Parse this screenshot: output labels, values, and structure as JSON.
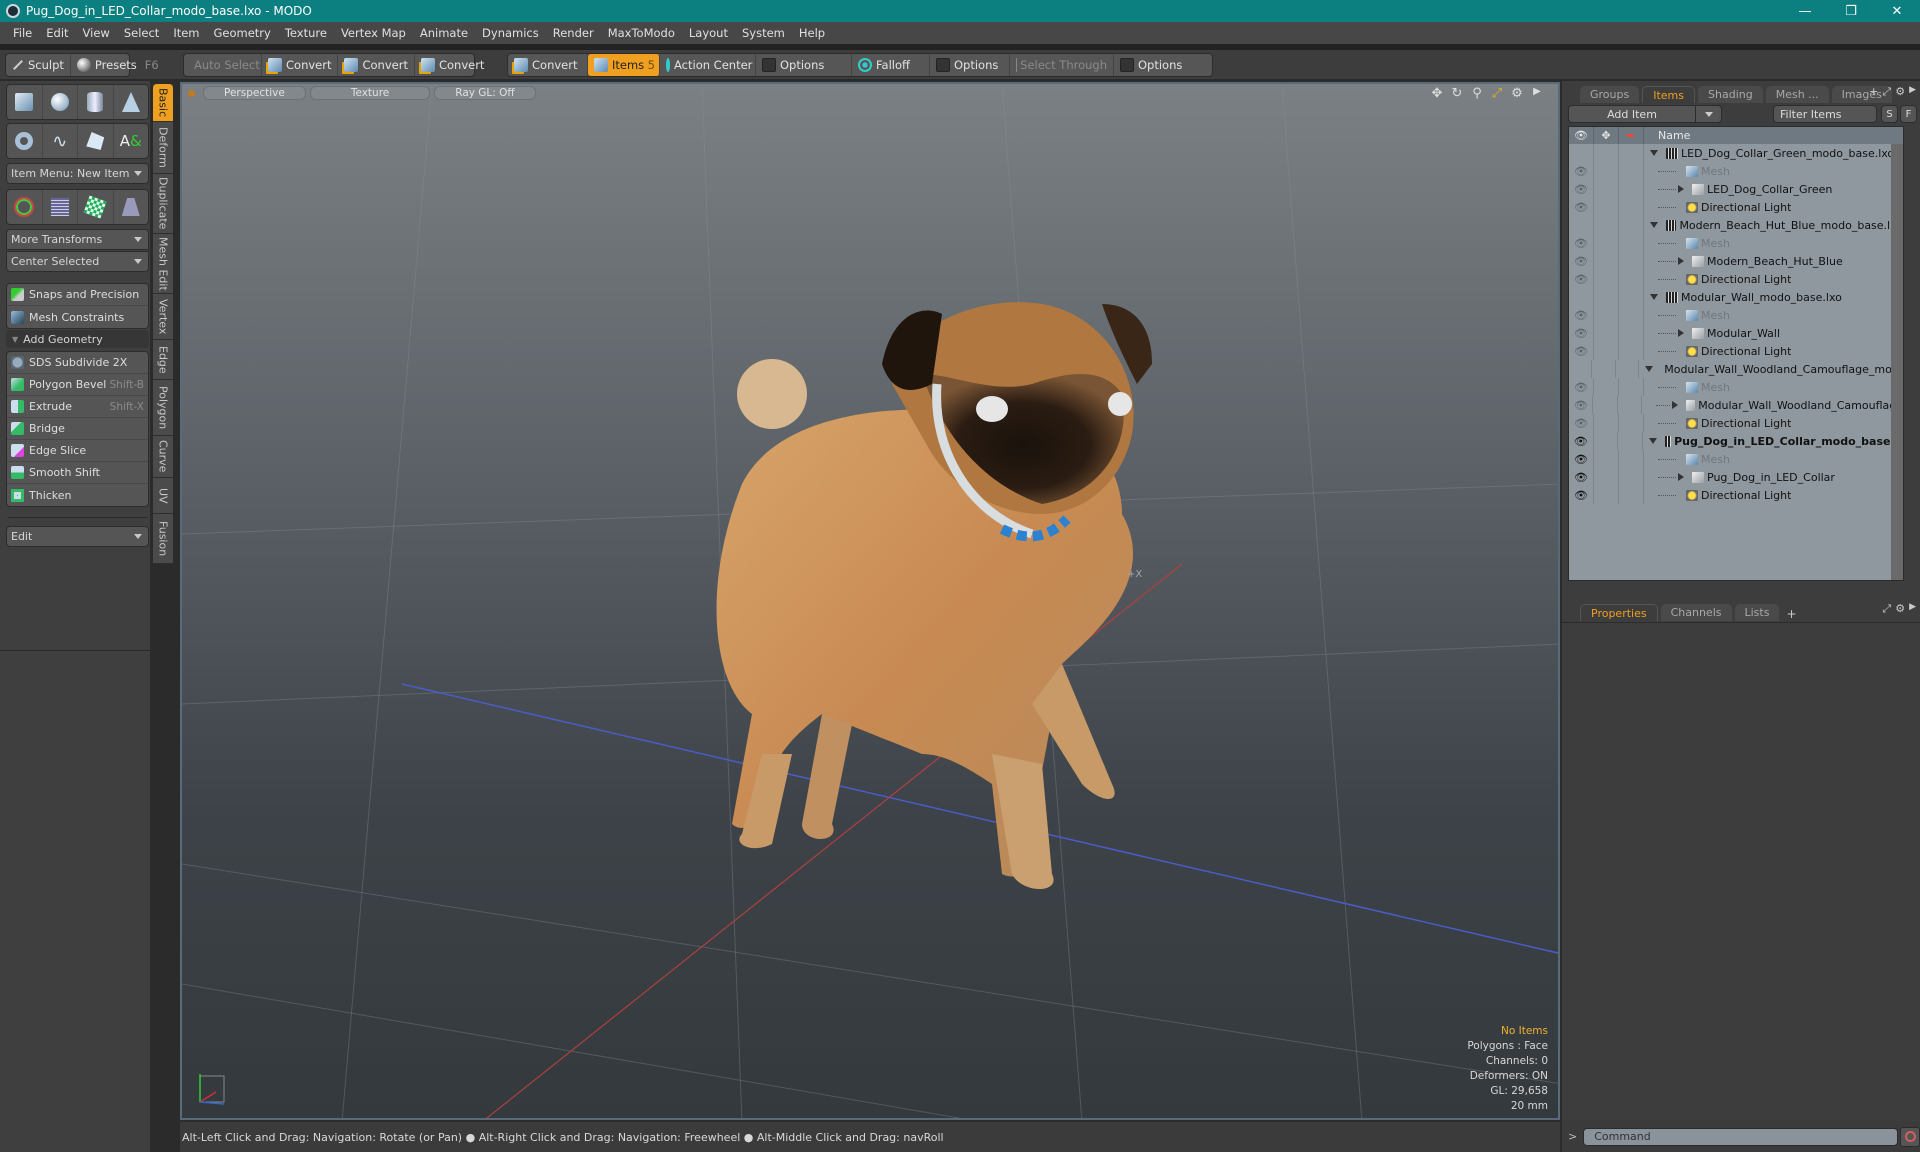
{
  "window": {
    "title": "Pug_Dog_in_LED_Collar_modo_base.lxo - MODO",
    "controls": [
      "minimize",
      "restore",
      "close"
    ]
  },
  "menu": [
    "File",
    "Edit",
    "View",
    "Select",
    "Item",
    "Geometry",
    "Texture",
    "Vertex Map",
    "Animate",
    "Dynamics",
    "Render",
    "MaxToModo",
    "Layout",
    "System",
    "Help"
  ],
  "toolbar": {
    "sculpt": "Sculpt",
    "presets": "Presets",
    "presets_shortcut": "F6",
    "auto_select": "Auto Select",
    "convert1": "Convert",
    "convert2": "Convert",
    "convert3": "Convert",
    "convert4": "Convert",
    "items": "Items",
    "items_count": "5",
    "action_center": "Action Center",
    "options1": "Options",
    "falloff": "Falloff",
    "options2": "Options",
    "select_through": "Select Through",
    "options3": "Options"
  },
  "left": {
    "item_menu": "Item Menu: New Item",
    "more_transforms": "More Transforms",
    "center_selected": "Center Selected",
    "snaps": "Snaps and Precision",
    "mesh_constraints": "Mesh Constraints",
    "add_geometry": "Add Geometry",
    "tools": [
      {
        "label": "SDS Subdivide 2X",
        "shortcut": ""
      },
      {
        "label": "Polygon Bevel",
        "shortcut": "Shift-B"
      },
      {
        "label": "Extrude",
        "shortcut": "Shift-X"
      },
      {
        "label": "Bridge",
        "shortcut": ""
      },
      {
        "label": "Edge Slice",
        "shortcut": ""
      },
      {
        "label": "Smooth Shift",
        "shortcut": ""
      },
      {
        "label": "Thicken",
        "shortcut": ""
      }
    ],
    "edit": "Edit",
    "vtabs": [
      "Basic",
      "Deform",
      "Duplicate",
      "Mesh Edit",
      "Vertex",
      "Edge",
      "Polygon",
      "Curve",
      "UV",
      "Fusion"
    ]
  },
  "viewport": {
    "view": "Perspective",
    "shading": "Texture",
    "raygl": "Ray GL: Off",
    "hud": {
      "selection": "No Items",
      "polygons": "Polygons : Face",
      "channels": "Channels: 0",
      "deformers": "Deformers: ON",
      "gl": "GL: 29,658",
      "units": "20 mm"
    },
    "axis_label": "+X"
  },
  "status": "Alt-Left Click and Drag: Navigation: Rotate (or Pan) ● Alt-Right Click and Drag: Navigation: Freewheel ● Alt-Middle Click and Drag: navRoll",
  "right": {
    "tabs": [
      "Groups",
      "Items",
      "Shading",
      "Mesh ...",
      "Images"
    ],
    "active_tab": "Items",
    "add_item": "Add Item",
    "filter": "Filter Items",
    "s_btn": "S",
    "f_btn": "F",
    "name_col": "Name",
    "items": [
      {
        "name": "LED_Dog_Collar_Green_modo_base.lxo",
        "type": "scene",
        "level": 0,
        "vis": false,
        "bold": false
      },
      {
        "name": "Mesh",
        "type": "mesh",
        "level": 1,
        "vis": true,
        "dim": true
      },
      {
        "name": "LED_Dog_Collar_Green",
        "type": "folder",
        "level": 1,
        "vis": true,
        "expand": true
      },
      {
        "name": "Directional Light",
        "type": "light",
        "level": 1,
        "vis": true
      },
      {
        "name": "Modern_Beach_Hut_Blue_modo_base.lxo",
        "type": "scene",
        "level": 0,
        "vis": false
      },
      {
        "name": "Mesh",
        "type": "mesh",
        "level": 1,
        "vis": true,
        "dim": true
      },
      {
        "name": "Modern_Beach_Hut_Blue",
        "type": "folder",
        "level": 1,
        "vis": true,
        "expand": true
      },
      {
        "name": "Directional Light",
        "type": "light",
        "level": 1,
        "vis": true
      },
      {
        "name": "Modular_Wall_modo_base.lxo",
        "type": "scene",
        "level": 0,
        "vis": false
      },
      {
        "name": "Mesh",
        "type": "mesh",
        "level": 1,
        "vis": true,
        "dim": true
      },
      {
        "name": "Modular_Wall",
        "type": "folder",
        "level": 1,
        "vis": true,
        "expand": true
      },
      {
        "name": "Directional Light",
        "type": "light",
        "level": 1,
        "vis": true
      },
      {
        "name": "Modular_Wall_Woodland_Camouflage_mod...",
        "type": "scene",
        "level": 0,
        "vis": false
      },
      {
        "name": "Mesh",
        "type": "mesh",
        "level": 1,
        "vis": true,
        "dim": true
      },
      {
        "name": "Modular_Wall_Woodland_Camouflage",
        "type": "folder",
        "level": 1,
        "vis": true,
        "expand": true
      },
      {
        "name": "Directional Light",
        "type": "light",
        "level": 1,
        "vis": true
      },
      {
        "name": "Pug_Dog_in_LED_Collar_modo_base...",
        "type": "scene",
        "level": 0,
        "vis": true,
        "bold": true,
        "active": true
      },
      {
        "name": "Mesh",
        "type": "mesh",
        "level": 1,
        "vis": true,
        "dim": true,
        "active": true
      },
      {
        "name": "Pug_Dog_in_LED_Collar",
        "type": "folder",
        "level": 1,
        "vis": true,
        "expand": true,
        "active": true
      },
      {
        "name": "Directional Light",
        "type": "light",
        "level": 1,
        "vis": true,
        "active": true
      }
    ],
    "prop_tabs": [
      "Properties",
      "Channels",
      "Lists"
    ],
    "command_placeholder": "Command"
  },
  "colors": {
    "accent": "#f0a020",
    "titlebar": "#0c7f80"
  }
}
